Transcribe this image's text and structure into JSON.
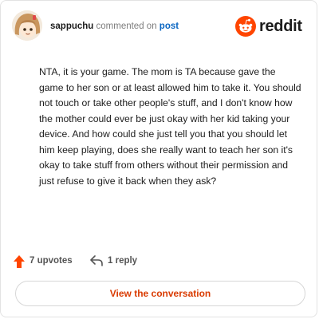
{
  "header": {
    "username": "sappuchu",
    "commented_on": "commented on",
    "post_label": "post",
    "brand_name": "reddit",
    "avatar_icon": "anime-avatar-icon",
    "brand_icon": "reddit-snoo-icon"
  },
  "comment": {
    "text": "NTA, it is your game. The mom is TA because gave the game to her son or at least allowed him to take it. You should not touch or take other people's stuff, and I don't know how the mother could ever be just okay with her kid taking your device. And how could she just tell you that you should let him keep playing, does she really want to teach her son it's okay to take stuff from others without their permission and just refuse to give it back when they ask?"
  },
  "actions": {
    "upvotes_label": "7 upvotes",
    "upvote_icon": "upvote-arrow-icon",
    "reply_label": "1 reply",
    "reply_icon": "reply-arrow-icon"
  },
  "cta": {
    "label": "View the conversation"
  },
  "colors": {
    "brand_orange": "#ff4500",
    "link_blue": "#0a66c2",
    "cta_text": "#d93a00"
  }
}
